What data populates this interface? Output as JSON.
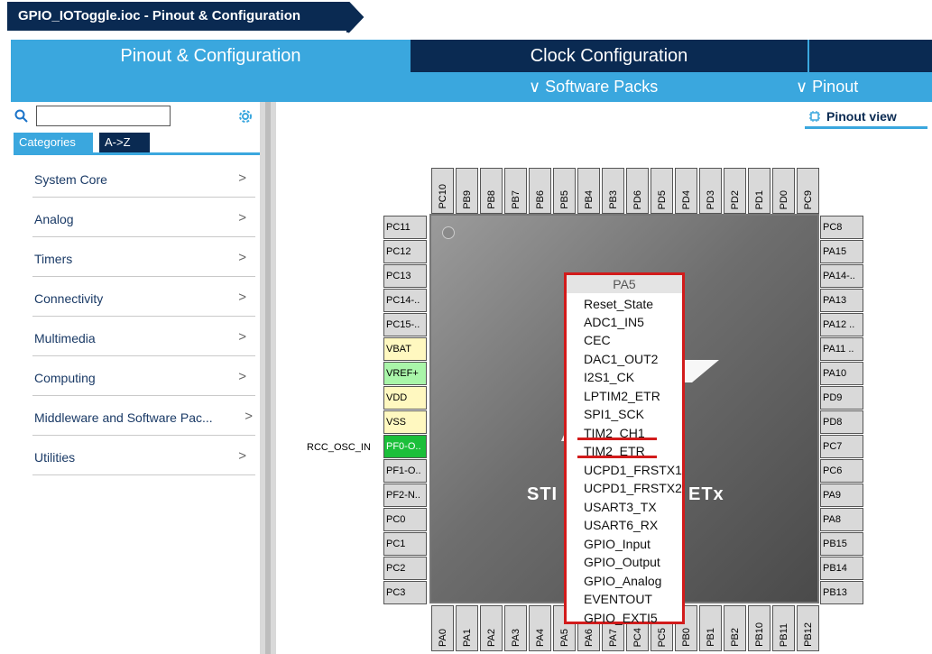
{
  "window": {
    "breadcrumb": "GPIO_IOToggle.ioc - Pinout & Configuration"
  },
  "tabs": [
    {
      "label": "Pinout & Configuration",
      "active": true
    },
    {
      "label": "Clock Configuration",
      "active": false
    }
  ],
  "subtabs": {
    "software_packs": "∨ Software Packs",
    "pinout": "∨ Pinout"
  },
  "left": {
    "search": {
      "value": "",
      "placeholder": ""
    },
    "tabs": {
      "categories": "Categories",
      "az": "A->Z"
    },
    "categories": [
      "System Core",
      "Analog",
      "Timers",
      "Connectivity",
      "Multimedia",
      "Computing",
      "Middleware and Software Pac...",
      "Utilities"
    ]
  },
  "pinout_view": {
    "label": "Pinout view"
  },
  "chip": {
    "name_left": "STI",
    "name_right": "ETx"
  },
  "pins": {
    "top": [
      "PC10",
      "PB9",
      "PB8",
      "PB7",
      "PB6",
      "PB5",
      "PB4",
      "PB3",
      "PD6",
      "PD5",
      "PD4",
      "PD3",
      "PD2",
      "PD1",
      "PD0",
      "PC9"
    ],
    "left": [
      "PC11",
      "PC12",
      "PC13",
      "PC14-..",
      "PC15-..",
      "VBAT",
      "VREF+",
      "VDD",
      "VSS",
      "PF0-O..",
      "PF1-O..",
      "PF2-N..",
      "PC0",
      "PC1",
      "PC2",
      "PC3"
    ],
    "right": [
      "PC8",
      "PA15",
      "PA14-..",
      "PA13",
      "PA12 ..",
      "PA11 ..",
      "PA10",
      "PD9",
      "PD8",
      "PC7",
      "PC6",
      "PA9",
      "PA8",
      "PB15",
      "PB14",
      "PB13"
    ],
    "bottom": [
      "PA0",
      "PA1",
      "PA2",
      "PA3",
      "PA4",
      "PA5",
      "PA6",
      "PA7",
      "PC4",
      "PC5",
      "PB0",
      "PB1",
      "PB2",
      "PB10",
      "PB11",
      "PB12"
    ]
  },
  "rcc_label": "RCC_OSC_IN",
  "popup": {
    "title": "PA5",
    "items": [
      "Reset_State",
      "ADC1_IN5",
      "CEC",
      "DAC1_OUT2",
      "I2S1_CK",
      "LPTIM2_ETR",
      "SPI1_SCK",
      "TIM2_CH1",
      "TIM2_ETR",
      "UCPD1_FRSTX1",
      "UCPD1_FRSTX2",
      "USART3_TX",
      "USART6_RX",
      "GPIO_Input",
      "GPIO_Output",
      "GPIO_Analog",
      "EVENTOUT",
      "GPIO_EXTI5"
    ]
  },
  "colors": {
    "navy": "#0a2a52",
    "accent": "#3aa7de",
    "highlight": "#d21b1b"
  }
}
